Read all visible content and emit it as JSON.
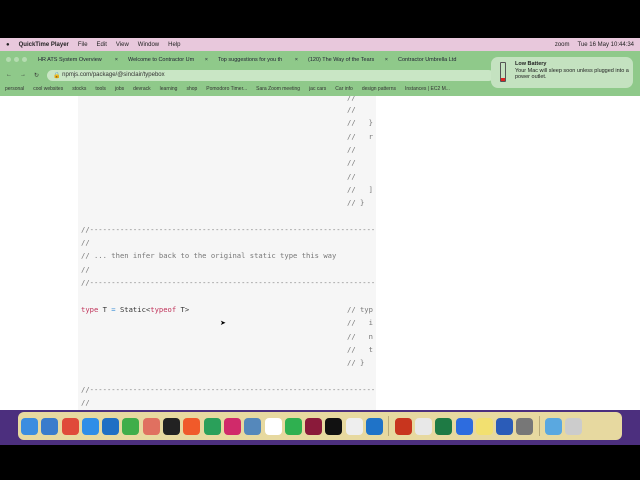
{
  "menubar": {
    "app": "QuickTime Player",
    "items": [
      "File",
      "Edit",
      "View",
      "Window",
      "Help"
    ],
    "status": [
      "zoom"
    ],
    "clock": "Tue 16 May  10:44:34"
  },
  "tabs": [
    {
      "label": "HR ATS System Overview"
    },
    {
      "label": "Welcome to Contractor Um"
    },
    {
      "label": "Top suggestions for you th"
    },
    {
      "label": "(120) The Way of the Tears"
    },
    {
      "label": "Contractor Umbrella Ltd"
    }
  ],
  "url": "npmjs.com/package/@sinclair/typebox",
  "bookmarks": [
    "personal",
    "cool websites",
    "stocks",
    "tools",
    "jobs",
    "devrack",
    "learning",
    "shop",
    "Pomodoro Timer...",
    "Sara Zoom meeting",
    "jac cars",
    "Car info",
    "design patterns",
    "Instances | EC2 M..."
  ],
  "notification": {
    "title": "Low Battery",
    "body": "Your Mac will sleep soon unless plugged into a power outlet."
  },
  "code": {
    "right_top": [
      "//",
      "//",
      "//   }",
      "//   r",
      "//",
      "//",
      "//",
      "//   ]",
      "// }"
    ],
    "rule": "//------------------------------------------------------------------",
    "blank": "//",
    "comment": "// ... then infer back to the original static type this way",
    "kw_type": "type",
    "ident": "T",
    "eq": "=",
    "static": "Static<",
    "kw_typeof": "typeof",
    "close": "T>",
    "right_mid": [
      "// typ",
      "//   i",
      "//   n",
      "//   t",
      "// }"
    ]
  },
  "dock": [
    "Finder",
    "Launchpad",
    "Chrome",
    "Safari",
    "VS Code",
    "Evernote",
    "Package",
    "Terminal",
    "Pencil",
    "DataGrip",
    "IntelliJ",
    "QuickTime",
    "Calendar 16",
    "Messages",
    "RubyMine",
    "Kindle",
    "TextEdit",
    "Trello",
    "PowerPoint",
    "News",
    "Excel",
    "Zoom",
    "Stickies",
    "Word",
    "System Preferences",
    "Downloads",
    "Trash"
  ]
}
